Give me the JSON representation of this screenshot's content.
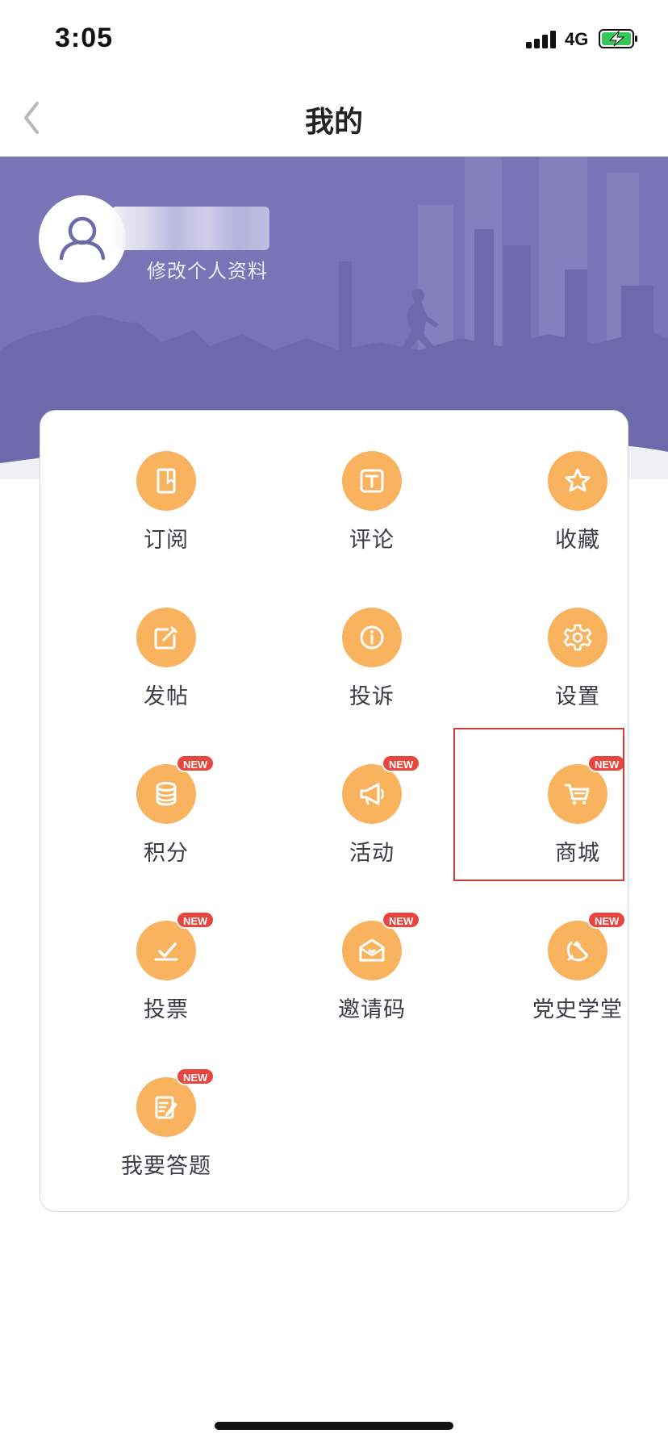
{
  "status_bar": {
    "time": "3:05",
    "network": "4G"
  },
  "nav": {
    "title": "我的",
    "back_icon": "chevron-left-icon"
  },
  "profile": {
    "edit_label": "修改个人资料",
    "avatar_icon": "user-icon"
  },
  "menu": {
    "badge_text": "NEW",
    "items": [
      {
        "label": "订阅",
        "icon": "book-icon",
        "is_new": false
      },
      {
        "label": "评论",
        "icon": "text-icon",
        "is_new": false
      },
      {
        "label": "收藏",
        "icon": "star-icon",
        "is_new": false
      },
      {
        "label": "发帖",
        "icon": "edit-icon",
        "is_new": false
      },
      {
        "label": "投诉",
        "icon": "info-icon",
        "is_new": false
      },
      {
        "label": "设置",
        "icon": "gear-icon",
        "is_new": false
      },
      {
        "label": "积分",
        "icon": "coins-icon",
        "is_new": true
      },
      {
        "label": "活动",
        "icon": "megaphone-icon",
        "is_new": true
      },
      {
        "label": "商城",
        "icon": "cart-icon",
        "is_new": true
      },
      {
        "label": "投票",
        "icon": "vote-icon",
        "is_new": true
      },
      {
        "label": "邀请码",
        "icon": "envelope-heart-icon",
        "is_new": true
      },
      {
        "label": "党史学堂",
        "icon": "hammer-sickle-icon",
        "is_new": true
      },
      {
        "label": "我要答题",
        "icon": "quiz-icon",
        "is_new": true
      }
    ]
  },
  "colors": {
    "hero_bg": "#7a74b6",
    "icon_bg": "#f9b25e",
    "badge_bg": "#e8453c",
    "highlight": "#d53a34"
  }
}
